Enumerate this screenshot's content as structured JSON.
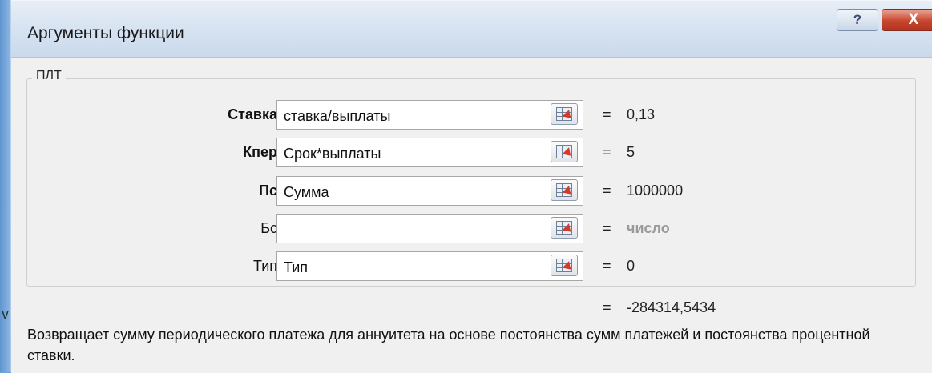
{
  "window": {
    "title": "Аргументы функции",
    "help_glyph": "?",
    "close_glyph": "X"
  },
  "function": {
    "name": "ПЛТ"
  },
  "arguments": [
    {
      "label": "Ставка",
      "value": "ставка/выплаты",
      "result": "0,13",
      "required": true
    },
    {
      "label": "Кпер",
      "value": "Срок*выплаты",
      "result": "5",
      "required": true
    },
    {
      "label": "Пс",
      "value": "Сумма",
      "result": "1000000",
      "required": true
    },
    {
      "label": "Бс",
      "value": "",
      "result": "число",
      "required": false
    },
    {
      "label": "Тип",
      "value": "Тип",
      "result": "0",
      "required": false
    }
  ],
  "equals_sign": "=",
  "formula_result": "-284314,5434",
  "description": "Возвращает сумму периодического платежа для аннуитета на основе постоянства сумм платежей и постоянства процентной ставки.",
  "colors": {
    "background": "#f0f0f0",
    "titlebar": "#d8e4f2",
    "close_button": "#c9452d"
  },
  "icons": {
    "help": "help-icon",
    "close": "close-icon",
    "range_select": "range-select-icon"
  }
}
